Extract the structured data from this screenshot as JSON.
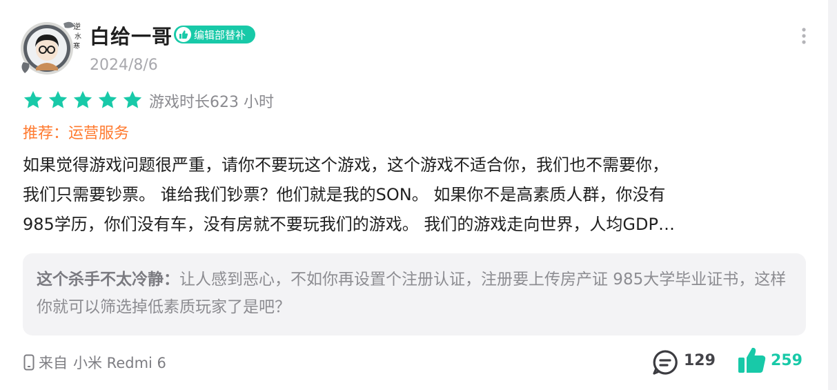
{
  "author": {
    "name": "白给一哥",
    "badge": "编辑部替补",
    "date": "2024/8/6",
    "avatar_icon": "avatar-portrait"
  },
  "rating": {
    "stars": 5,
    "max_stars": 5,
    "star_color": "#18c9a8",
    "playtime": "游戏时长623 小时"
  },
  "recommend": "推荐：运营服务",
  "body_lines": [
    "如果觉得游戏问题很严重，请你不要玩这个游戏，这个游戏不适合你，我们也不需要你，",
    "我们只需要钞票。 谁给我们钞票？他们就是我的SON。 如果你不是高素质人群，你没有",
    "985学历，你们没有车，没有房就不要玩我们的游戏。 我们的游戏走向世界，人均GDP…"
  ],
  "reply": {
    "author": "这个杀手不太冷静：",
    "text": "让人感到恶心，不如你再设置个注册认证，注册要上传房产证 985大学毕业证书，这样你就可以筛选掉低素质玩家了是吧？"
  },
  "device": {
    "prefix": "来自",
    "model": "小米 Redmi 6",
    "icon": "phone-icon"
  },
  "stats": {
    "comments": "129",
    "likes": "259",
    "accent_color": "#18c9a8"
  },
  "icons": {
    "more": "more-vertical-icon",
    "comment": "comment-icon",
    "like": "thumbs-up-icon"
  }
}
